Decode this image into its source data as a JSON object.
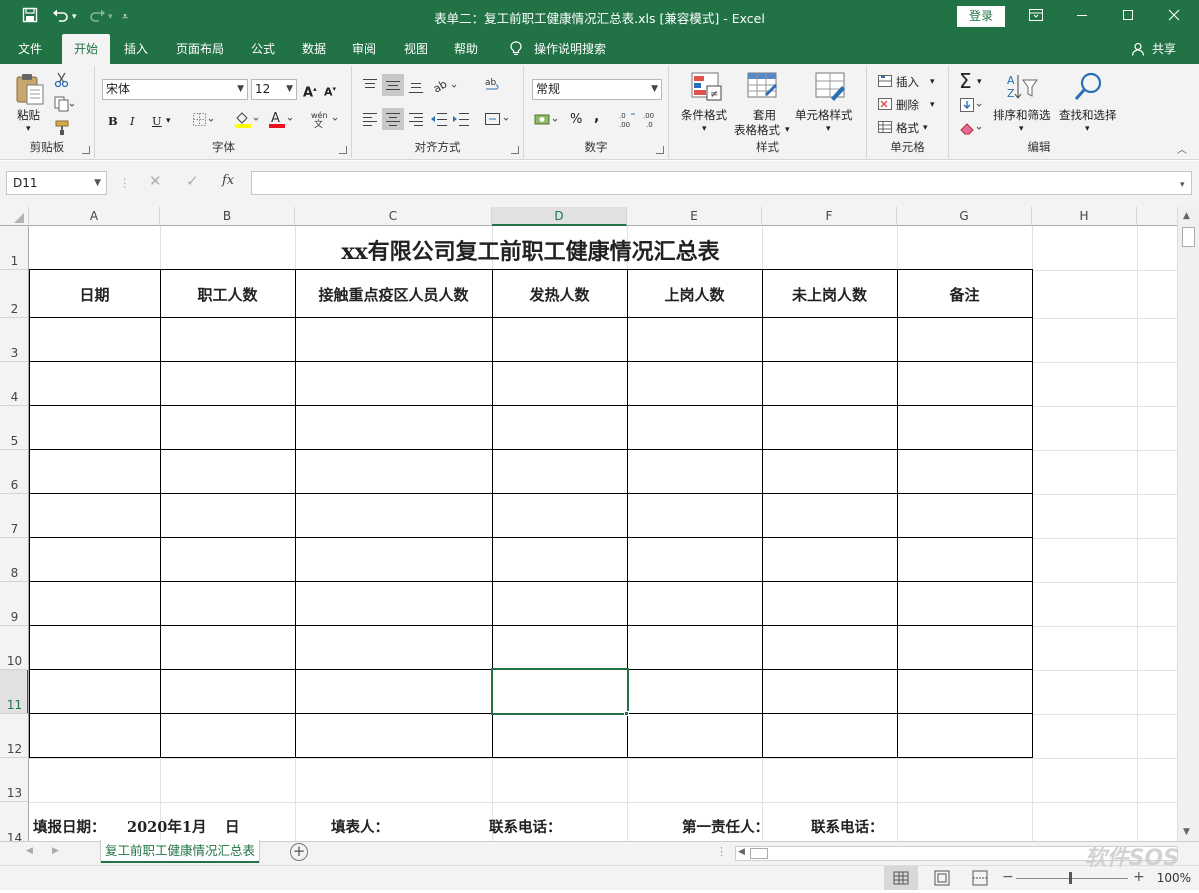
{
  "window": {
    "title": "表单二：复工前职工健康情况汇总表.xls  [兼容模式]  -  Excel",
    "login": "登录"
  },
  "menu": {
    "tabs": [
      "文件",
      "开始",
      "插入",
      "页面布局",
      "公式",
      "数据",
      "审阅",
      "视图",
      "帮助"
    ],
    "active": "开始",
    "tell_me": "操作说明搜索",
    "share": "共享"
  },
  "ribbon": {
    "clipboard": {
      "paste": "粘贴",
      "group": "剪贴板"
    },
    "font": {
      "name": "宋体",
      "size": "12",
      "bold": "B",
      "italic": "I",
      "underline": "U",
      "group": "字体"
    },
    "alignment": {
      "group": "对齐方式"
    },
    "number": {
      "format": "常规",
      "group": "数字"
    },
    "styles": {
      "conditional": "条件格式",
      "table_line1": "套用",
      "table_line2": "表格格式",
      "cell_styles": "单元格样式",
      "group": "样式"
    },
    "cells": {
      "insert": "插入",
      "delete": "删除",
      "format": "格式",
      "group": "单元格"
    },
    "editing": {
      "sort": "排序和筛选",
      "find": "查找和选择",
      "group": "编辑"
    }
  },
  "formula_bar": {
    "name_box": "D11",
    "fx": "fx",
    "formula": ""
  },
  "grid": {
    "columns": [
      "A",
      "B",
      "C",
      "D",
      "E",
      "F",
      "G",
      "H"
    ],
    "rows": [
      "1",
      "2",
      "3",
      "4",
      "5",
      "6",
      "7",
      "8",
      "9",
      "10",
      "11",
      "12",
      "13",
      "14"
    ],
    "selected_cell": "D11"
  },
  "sheet": {
    "title": "xx有限公司复工前职工健康情况汇总表",
    "headers": [
      "日期",
      "职工人数",
      "接触重点疫区人员人数",
      "发热人数",
      "上岗人数",
      "未上岗人数",
      "备注"
    ],
    "footer": {
      "date_label": "填报日期：",
      "date_value": "2020年1月",
      "day": "日",
      "filler": "填表人：",
      "phone": "联系电话：",
      "responsible": "第一责任人：",
      "phone2": "联系电话："
    }
  },
  "sheet_tabs": [
    "复工前职工健康情况汇总表"
  ],
  "status": {
    "zoom": "100%"
  },
  "watermark": "软件SOS"
}
